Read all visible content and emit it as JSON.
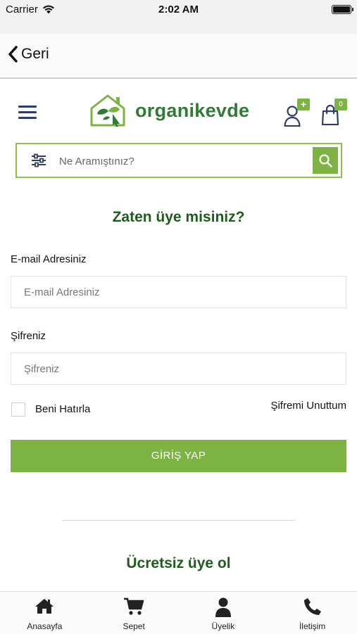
{
  "status_bar": {
    "carrier": "Carrier",
    "time": "2:02 AM"
  },
  "nav": {
    "back_label": "Geri"
  },
  "header": {
    "logo_text": "organikevde",
    "user_badge": "+",
    "cart_badge": "0"
  },
  "search": {
    "placeholder": "Ne Aramıştınız?"
  },
  "login": {
    "title": "Zaten üye misiniz?",
    "email_label": "E-mail Adresiniz",
    "email_placeholder": "E-mail Adresiniz",
    "password_label": "Şifreniz",
    "password_placeholder": "Şifreniz",
    "remember_label": "Beni Hatırla",
    "forgot_label": "Şifremi Unuttum",
    "submit_label": "GİRİŞ YAP"
  },
  "register": {
    "title": "Ücretsiz üye ol"
  },
  "tab_bar": {
    "items": [
      {
        "label": "Anasayfa",
        "icon": "home-icon"
      },
      {
        "label": "Sepet",
        "icon": "cart-icon"
      },
      {
        "label": "Üyelik",
        "icon": "person-icon"
      },
      {
        "label": "İletişim",
        "icon": "phone-icon"
      }
    ]
  },
  "colors": {
    "accent_green": "#7cb342",
    "title_green": "#1f5b1f",
    "logo_green": "#2e7d32"
  }
}
